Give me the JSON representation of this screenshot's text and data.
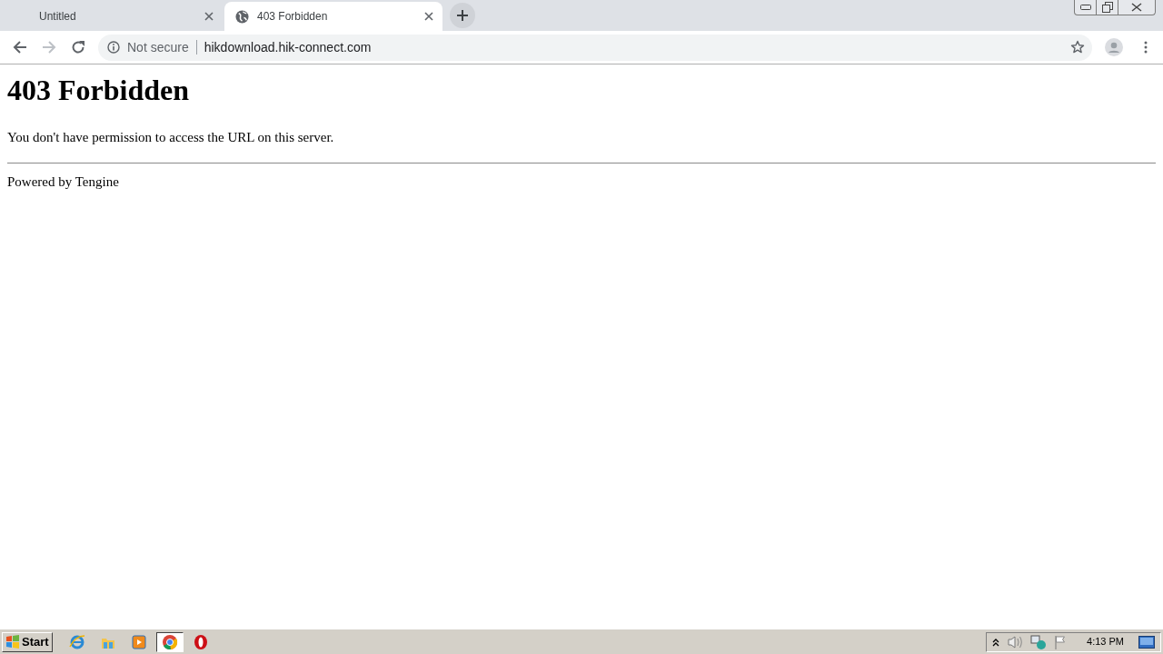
{
  "browser": {
    "tabs": [
      {
        "title": "Untitled",
        "selected": false
      },
      {
        "title": "403 Forbidden",
        "selected": true
      }
    ],
    "address_bar": {
      "security_label": "Not secure",
      "url": "hikdownload.hik-connect.com"
    }
  },
  "page": {
    "heading": "403 Forbidden",
    "message": "You don't have permission to access the URL on this server.",
    "footer": "Powered by Tengine"
  },
  "taskbar": {
    "start_label": "Start",
    "apps": [
      {
        "kind": "ie",
        "selected": false
      },
      {
        "kind": "folder",
        "selected": false
      },
      {
        "kind": "media",
        "selected": false
      },
      {
        "kind": "chrome",
        "selected": true
      },
      {
        "kind": "opera",
        "selected": false
      }
    ],
    "clock": "4:13 PM"
  }
}
